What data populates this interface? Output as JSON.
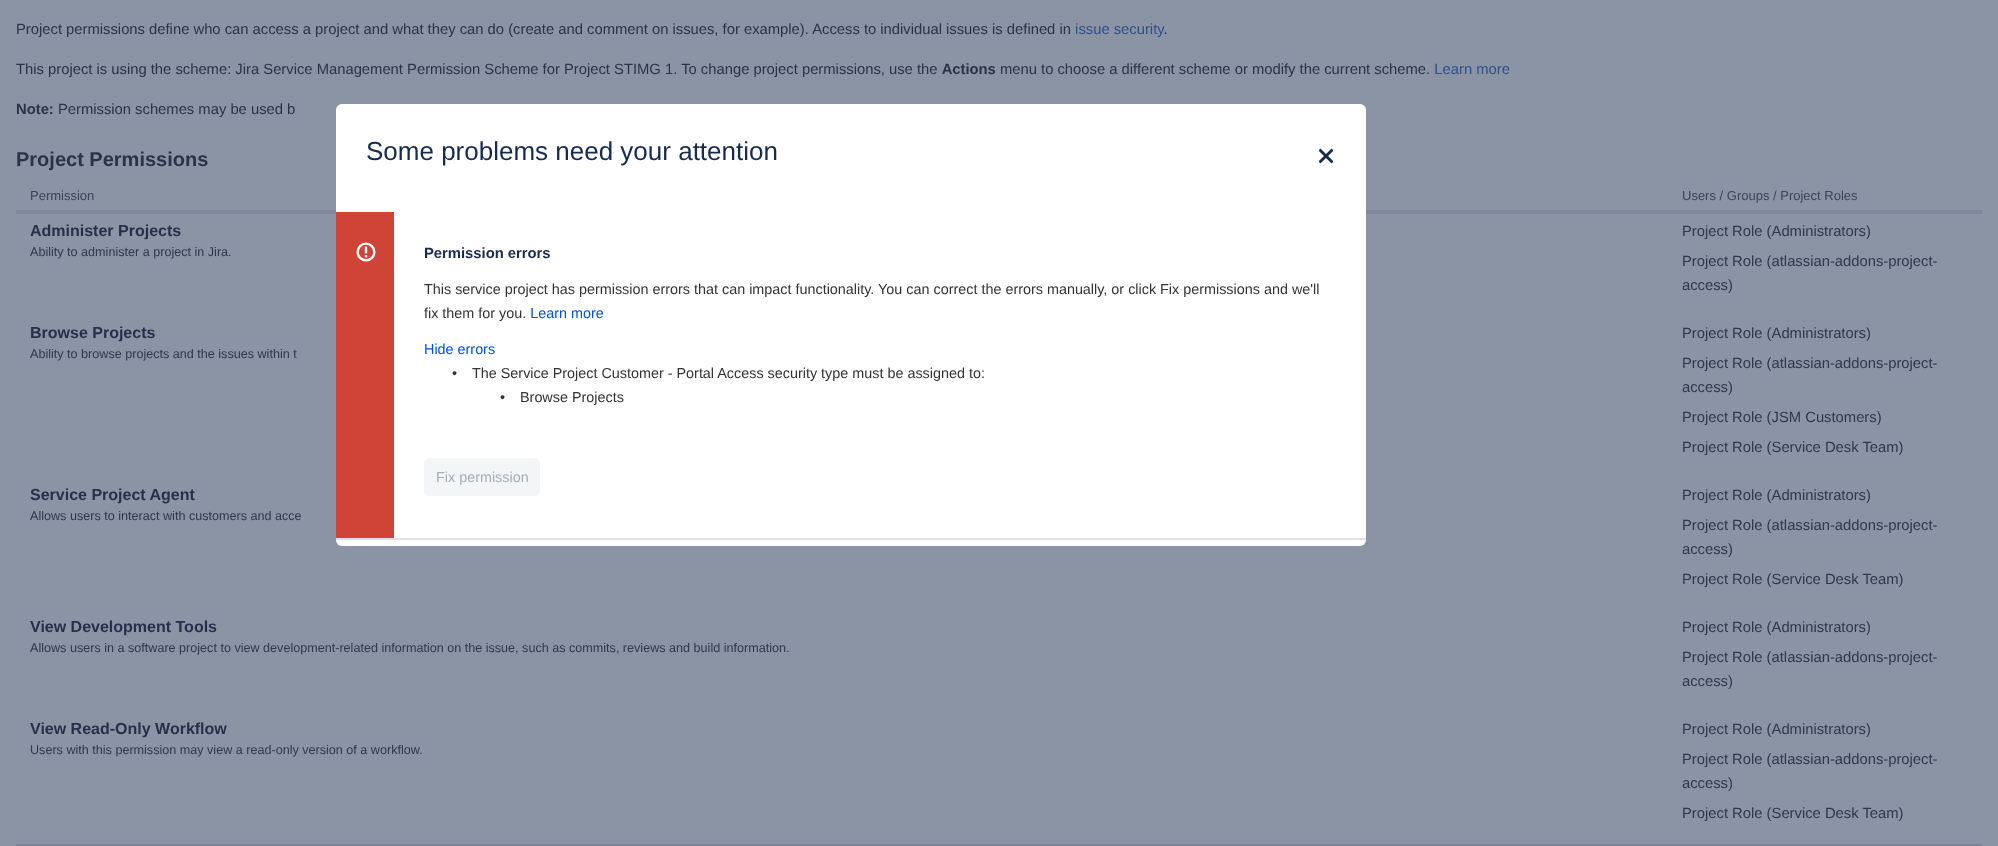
{
  "intro": [
    {
      "text": "Project permissions define who can access a project and what they can do (create and comment on issues, for example). Access to individual issues is defined in",
      "link": "issue security",
      "after": "."
    },
    {
      "text": "This project is using the scheme: Jira Service Management Permission Scheme for Project STIMG 1. To change project permissions, use the **Actions** menu to choose a different scheme or modify the current scheme.",
      "link": "Learn more"
    },
    {
      "text": "**Note:** Permission schemes may be used b"
    }
  ],
  "section_title": "Project Permissions",
  "table": {
    "columns": [
      "Permission",
      "Users / Groups / Project Roles"
    ],
    "rows": [
      {
        "name": "Administer Projects",
        "description": "Ability to administer a project in Jira.",
        "roles": [
          "Project Role (Administrators)",
          "Project Role (atlassian-addons-project-access)"
        ]
      },
      {
        "name": "Browse Projects",
        "description": "Ability to browse projects and the issues within t",
        "roles": [
          "Project Role (Administrators)",
          "Project Role (atlassian-addons-project-access)",
          "Project Role (JSM Customers)",
          "Project Role (Service Desk Team)"
        ]
      },
      {
        "name": "Service Project Agent",
        "description": "Allows users to interact with customers and acce",
        "roles": [
          "Project Role (Administrators)",
          "Project Role (atlassian-addons-project-access)",
          "Project Role (Service Desk Team)"
        ]
      },
      {
        "name": "View Development Tools",
        "description": "Allows users in a software project to view development-related information on the issue, such as commits, reviews and build information.",
        "roles": [
          "Project Role (Administrators)",
          "Project Role (atlassian-addons-project-access)"
        ]
      },
      {
        "name": "View Read-Only Workflow",
        "description": "Users with this permission may view a read-only version of a workflow.",
        "roles": [
          "Project Role (Administrators)",
          "Project Role (atlassian-addons-project-access)",
          "Project Role (Service Desk Team)"
        ]
      }
    ]
  },
  "dialog": {
    "title": "Some problems need your attention",
    "alert": {
      "title": "Permission errors",
      "message": "This service project has permission errors that can impact functionality. You can correct the errors manually, or click Fix permissions and we'll fix them for you.",
      "link": "Learn more",
      "toggle": "Hide errors",
      "errors": [
        {
          "marker": "•",
          "text": "The Service Project Customer - Portal Access security type must be assigned to:",
          "children": [
            {
              "marker": "•",
              "text": "Browse Projects"
            }
          ]
        }
      ]
    },
    "button": {
      "label": "Fix permission",
      "disabled": true
    }
  }
}
